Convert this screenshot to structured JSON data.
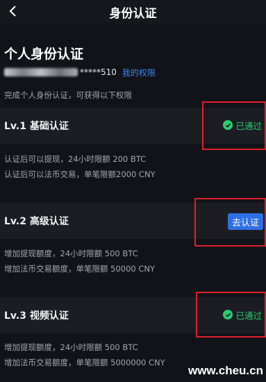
{
  "nav": {
    "title": "身份认证"
  },
  "hero": {
    "title": "个人身份认证",
    "account_suffix": "*****510",
    "rights_link": "我的权限",
    "hint": "完成个人身份认证，可获得以下权限"
  },
  "levels": [
    {
      "title": "Lv.1 基础认证",
      "status": "已通过",
      "action": "",
      "lines": [
        "认证后可以提现，24小时限额 200 BTC",
        "认证后可以法币交易，单笔限额2000 CNY"
      ]
    },
    {
      "title": "Lv.2 高级认证",
      "status": "",
      "action": "去认证",
      "lines": [
        "增加提现额度，24小时限额 500 BTC",
        "增加法币交易额度，单笔限额 50000 CNY"
      ]
    },
    {
      "title": "Lv.3 视频认证",
      "status": "已通过",
      "action": "",
      "lines": [
        "增加提现额度，24小时限额 500 BTC",
        "增加法币交易额度，单笔限额 5000000 CNY"
      ]
    }
  ],
  "watermark": "www.cheu.cn",
  "colors": {
    "background": "#111318",
    "accent_blue": "#2f6fe4",
    "success_green": "#2ecc71",
    "annotation_red": "#e0212b"
  }
}
